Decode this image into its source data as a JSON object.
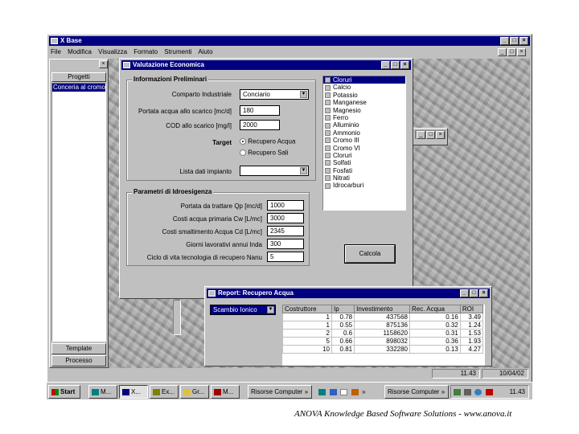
{
  "app": {
    "title": "X Base",
    "menu": [
      "File",
      "Modifica",
      "Visualizza",
      "Formato",
      "Strumenti",
      "Aiuto"
    ]
  },
  "left_panel": {
    "header": "Progetti",
    "selected_item": "Conceria al cromo.s",
    "bottom_buttons": [
      "Template",
      "Processo"
    ]
  },
  "dialog": {
    "title": "Valutazione Economica",
    "group_preliminari": {
      "title": "Informazioni Preliminari",
      "comparto_label": "Comparto Industriale",
      "comparto_value": "Conciario",
      "portata_label": "Portata acqua allo scarico [mc/d]",
      "portata_value": "180",
      "cod_label": "COD allo scarico [mg/l]",
      "cod_value": "2000",
      "target_label": "Target",
      "radio_acqua": "Recupero Acqua",
      "radio_sali": "Recupero Sali",
      "lista_label": "Lista dati impianto",
      "lista_value": ""
    },
    "group_idrosigenza": {
      "title": "Parametri di Idroesigenza",
      "fields": [
        {
          "label": "Portata da trattare Qp [mc/d]",
          "value": "1000"
        },
        {
          "label": "Costi acqua primaria Cw [L/mc]",
          "value": "3000"
        },
        {
          "label": "Costi smaltimento Acqua Cd [L/mc]",
          "value": "2345"
        },
        {
          "label": "Giorni lavorativi annui Inda",
          "value": "300"
        },
        {
          "label": "Ciclo di vita tecnologia di recupero Nanu",
          "value": "5"
        }
      ]
    },
    "calc_button": "Calcola",
    "substances": [
      "Cloruri",
      "Calcio",
      "Potassio",
      "Manganese",
      "Magnesio",
      "Ferro",
      "Alluminio",
      "Ammonio",
      "Cromo III",
      "Cromo VI",
      "Cloruri",
      "Solfati",
      "Fosfati",
      "Nitrati",
      "Idrocarburi"
    ]
  },
  "report": {
    "title": "Report: Recupero Acqua",
    "combo_value": "Scambio Ionico",
    "columns": [
      "Costruttore",
      "Ip",
      "Investimento",
      "Rec. Acqua",
      "ROI"
    ],
    "rows": [
      [
        "1",
        "0.78",
        "437568",
        "0.16",
        "3.49"
      ],
      [
        "1",
        "0.55",
        "875136",
        "0.32",
        "1.24"
      ],
      [
        "2",
        "0.6",
        "1158620",
        "0.31",
        "1.53"
      ],
      [
        "5",
        "0.66",
        "898032",
        "0.36",
        "1.93"
      ],
      [
        "10",
        "0.81",
        "332280",
        "0.13",
        "4.27"
      ]
    ]
  },
  "status_bar": {
    "time": "11.43",
    "date": "10/04/02"
  },
  "taskbar": {
    "start_label": "Start",
    "buttons": [
      "M...",
      "X...",
      "Ex...",
      "Gr...",
      "M...",
      "Risorse Computer",
      "Risorse Computer"
    ],
    "clock": "11.43"
  },
  "footer": {
    "text": "ANOVA Knowledge Based Software Solutions -  www.anova.it"
  }
}
